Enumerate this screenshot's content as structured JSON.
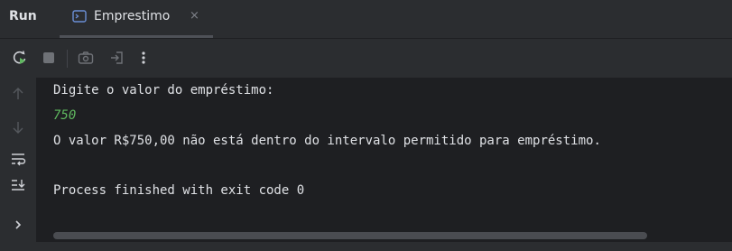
{
  "panel": {
    "title": "Run"
  },
  "tab": {
    "label": "Emprestimo",
    "close": "×"
  },
  "toolbar": {
    "buttons": [
      "rerun-icon",
      "stop-icon",
      "screenshot-icon",
      "exit-icon",
      "more-icon"
    ]
  },
  "gutter": {
    "buttons": [
      "arrow-up-icon",
      "arrow-down-icon",
      "soft-wrap-icon",
      "scroll-to-end-icon",
      "chevron-right-icon"
    ]
  },
  "console": {
    "lines": [
      {
        "text": "Digite o valor do empréstimo:",
        "kind": "output"
      },
      {
        "text": "750",
        "kind": "input"
      },
      {
        "text": "O valor R$750,00 não está dentro do intervalo permitido para empréstimo.",
        "kind": "output"
      },
      {
        "text": "",
        "kind": "output"
      },
      {
        "text": "Process finished with exit code 0",
        "kind": "output"
      }
    ]
  },
  "colors": {
    "background": "#1e1f22",
    "panel": "#2b2d30",
    "text": "#dfe1e5",
    "input_text": "#5fb85f",
    "rerun_green": "#5fb85f"
  }
}
